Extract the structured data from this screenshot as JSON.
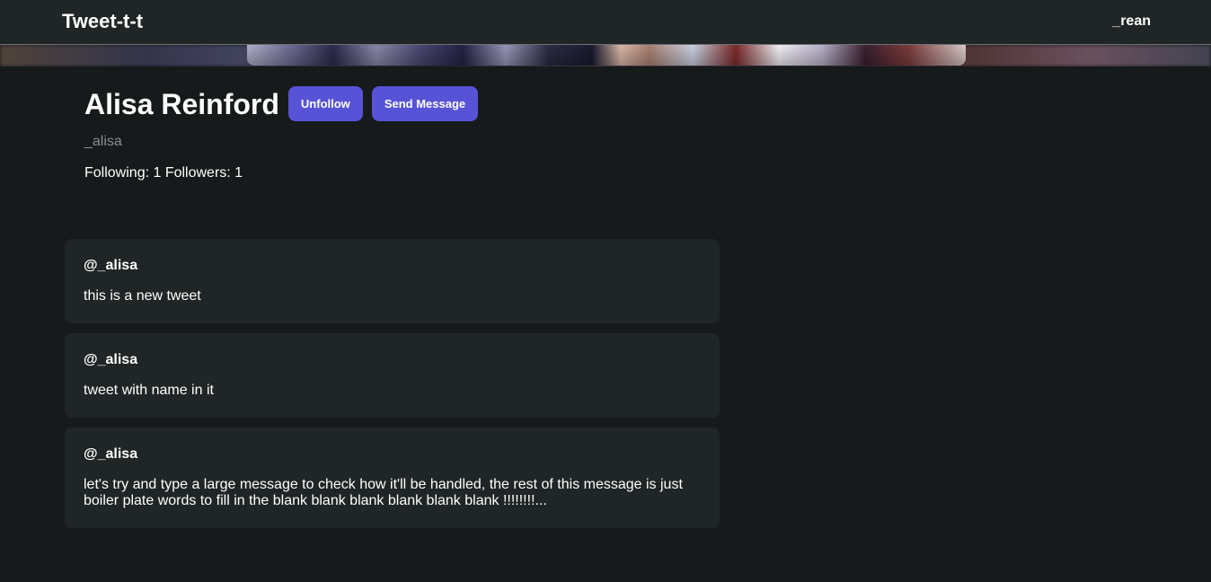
{
  "navbar": {
    "brand": "Tweet-t-t",
    "current_user": "_rean"
  },
  "profile": {
    "name": "Alisa Reinford",
    "handle": "_alisa",
    "unfollow_label": "Unfollow",
    "send_message_label": "Send Message",
    "stats": "Following: 1 Followers: 1"
  },
  "tweets": [
    {
      "author": "@_alisa",
      "text": "this is a new tweet"
    },
    {
      "author": "@_alisa",
      "text": "tweet with name in it"
    },
    {
      "author": "@_alisa",
      "text": "let's try and type a large message to check how it'll be handled, the rest of this message is just boiler plate words to fill in the blank blank blank blank blank blank !!!!!!!!..."
    }
  ],
  "colors": {
    "page_background": "#161a1b",
    "navbar_background": "#202526",
    "card_background": "#202526",
    "accent": "#5753d6",
    "muted_text": "#8b8f93"
  }
}
